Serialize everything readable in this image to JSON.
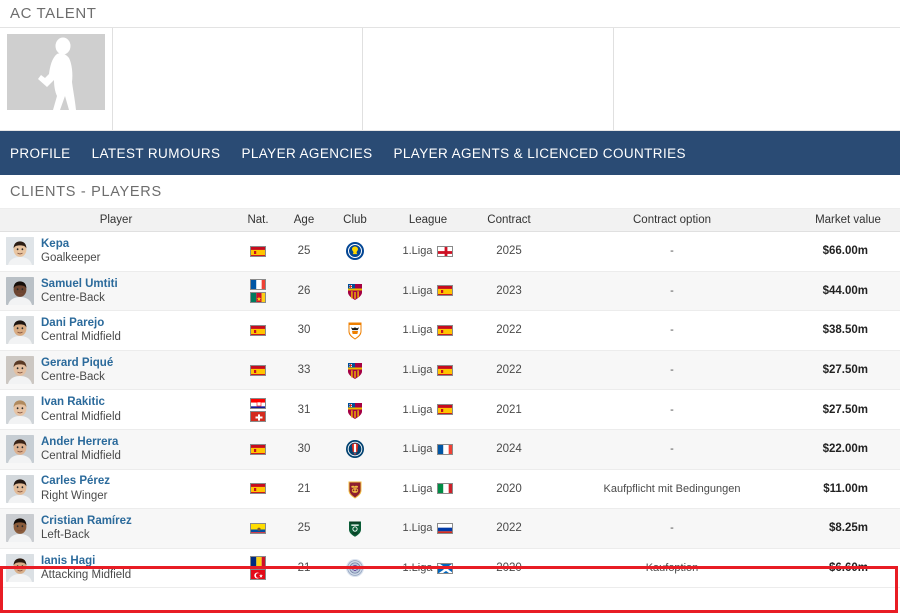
{
  "brand": {
    "title": "AC TALENT",
    "portrait_icon": "player-silhouette-icon"
  },
  "nav": {
    "items": [
      {
        "label": "PROFILE",
        "name": "nav-profile"
      },
      {
        "label": "LATEST RUMOURS",
        "name": "nav-latest-rumours"
      },
      {
        "label": "PLAYER AGENCIES",
        "name": "nav-player-agencies"
      },
      {
        "label": "PLAYER AGENTS & LICENCED COUNTRIES",
        "name": "nav-player-agents-licenced-countries"
      }
    ],
    "background_color": "#2a4b74"
  },
  "section": {
    "title": "CLIENTS - PLAYERS"
  },
  "table": {
    "headers": {
      "player": "Player",
      "nat": "Nat.",
      "age": "Age",
      "club": "Club",
      "league": "League",
      "contract": "Contract",
      "contract_option": "Contract option",
      "market_value": "Market value"
    },
    "link_color": "#3f7cae",
    "rows": [
      {
        "name": "Kepa",
        "position": "Goalkeeper",
        "nationalities": [
          "Spain"
        ],
        "age": "25",
        "club": "Chelsea FC",
        "league": "1.Liga",
        "league_country": "England",
        "contract": "2025",
        "contract_option": "-",
        "market_value": "$66.00m"
      },
      {
        "name": "Samuel Umtiti",
        "position": "Centre-Back",
        "nationalities": [
          "France",
          "Cameroon"
        ],
        "age": "26",
        "club": "FC Barcelona",
        "league": "1.Liga",
        "league_country": "Spain",
        "contract": "2023",
        "contract_option": "-",
        "market_value": "$44.00m"
      },
      {
        "name": "Dani Parejo",
        "position": "Central Midfield",
        "nationalities": [
          "Spain"
        ],
        "age": "30",
        "club": "Valencia CF",
        "league": "1.Liga",
        "league_country": "Spain",
        "contract": "2022",
        "contract_option": "-",
        "market_value": "$38.50m"
      },
      {
        "name": "Gerard Piqué",
        "position": "Centre-Back",
        "nationalities": [
          "Spain"
        ],
        "age": "33",
        "club": "FC Barcelona",
        "league": "1.Liga",
        "league_country": "Spain",
        "contract": "2022",
        "contract_option": "-",
        "market_value": "$27.50m"
      },
      {
        "name": "Ivan Rakitic",
        "position": "Central Midfield",
        "nationalities": [
          "Croatia",
          "Switzerland"
        ],
        "age": "31",
        "club": "FC Barcelona",
        "league": "1.Liga",
        "league_country": "Spain",
        "contract": "2021",
        "contract_option": "-",
        "market_value": "$27.50m"
      },
      {
        "name": "Ander Herrera",
        "position": "Central Midfield",
        "nationalities": [
          "Spain"
        ],
        "age": "30",
        "club": "Paris Saint-Germain",
        "league": "1.Liga",
        "league_country": "France",
        "contract": "2024",
        "contract_option": "-",
        "market_value": "$22.00m"
      },
      {
        "name": "Carles Pérez",
        "position": "Right Winger",
        "nationalities": [
          "Spain"
        ],
        "age": "21",
        "club": "AS Roma",
        "league": "1.Liga",
        "league_country": "Italy",
        "contract": "2020",
        "contract_option": "Kaufpflicht mit Bedingungen",
        "market_value": "$11.00m"
      },
      {
        "name": "Cristian Ramírez",
        "position": "Left-Back",
        "nationalities": [
          "Ecuador"
        ],
        "age": "25",
        "club": "FC Krasnodar",
        "league": "1.Liga",
        "league_country": "Russia",
        "contract": "2022",
        "contract_option": "-",
        "market_value": "$8.25m"
      },
      {
        "name": "Ianis Hagi",
        "position": "Attacking Midfield",
        "nationalities": [
          "Romania",
          "Turkey"
        ],
        "age": "21",
        "club": "Rangers FC",
        "league": "1.Liga",
        "league_country": "Scotland",
        "contract": "2020",
        "contract_option": "Kaufoption",
        "market_value": "$6.60m",
        "highlighted": true
      }
    ]
  },
  "highlight": {
    "color": "#e81c24",
    "target_row": "Ianis Hagi"
  }
}
